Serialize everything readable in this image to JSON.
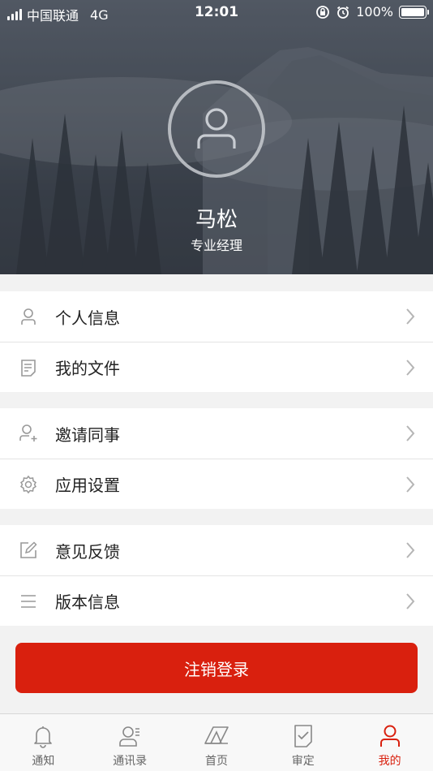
{
  "status_bar": {
    "carrier": "中国联通",
    "network": "4G",
    "time": "12:01",
    "battery": "100%"
  },
  "profile": {
    "name": "马松",
    "title": "专业经理"
  },
  "menu": {
    "groups": [
      [
        {
          "label": "个人信息",
          "icon": "person-icon"
        },
        {
          "label": "我的文件",
          "icon": "file-icon"
        }
      ],
      [
        {
          "label": "邀请同事",
          "icon": "add-person-icon"
        },
        {
          "label": "应用设置",
          "icon": "gear-icon"
        }
      ],
      [
        {
          "label": "意见反馈",
          "icon": "edit-icon"
        },
        {
          "label": "版本信息",
          "icon": "list-icon"
        }
      ]
    ]
  },
  "logout_label": "注销登录",
  "tabbar": {
    "active_index": 4,
    "tabs": [
      {
        "label": "通知",
        "icon": "bell-icon"
      },
      {
        "label": "通讯录",
        "icon": "contacts-icon"
      },
      {
        "label": "首页",
        "icon": "home-logo-icon"
      },
      {
        "label": "审定",
        "icon": "approve-icon"
      },
      {
        "label": "我的",
        "icon": "me-icon"
      }
    ]
  },
  "colors": {
    "accent": "#d9200e",
    "hero": "#3a414b",
    "background": "#f2f2f2"
  }
}
